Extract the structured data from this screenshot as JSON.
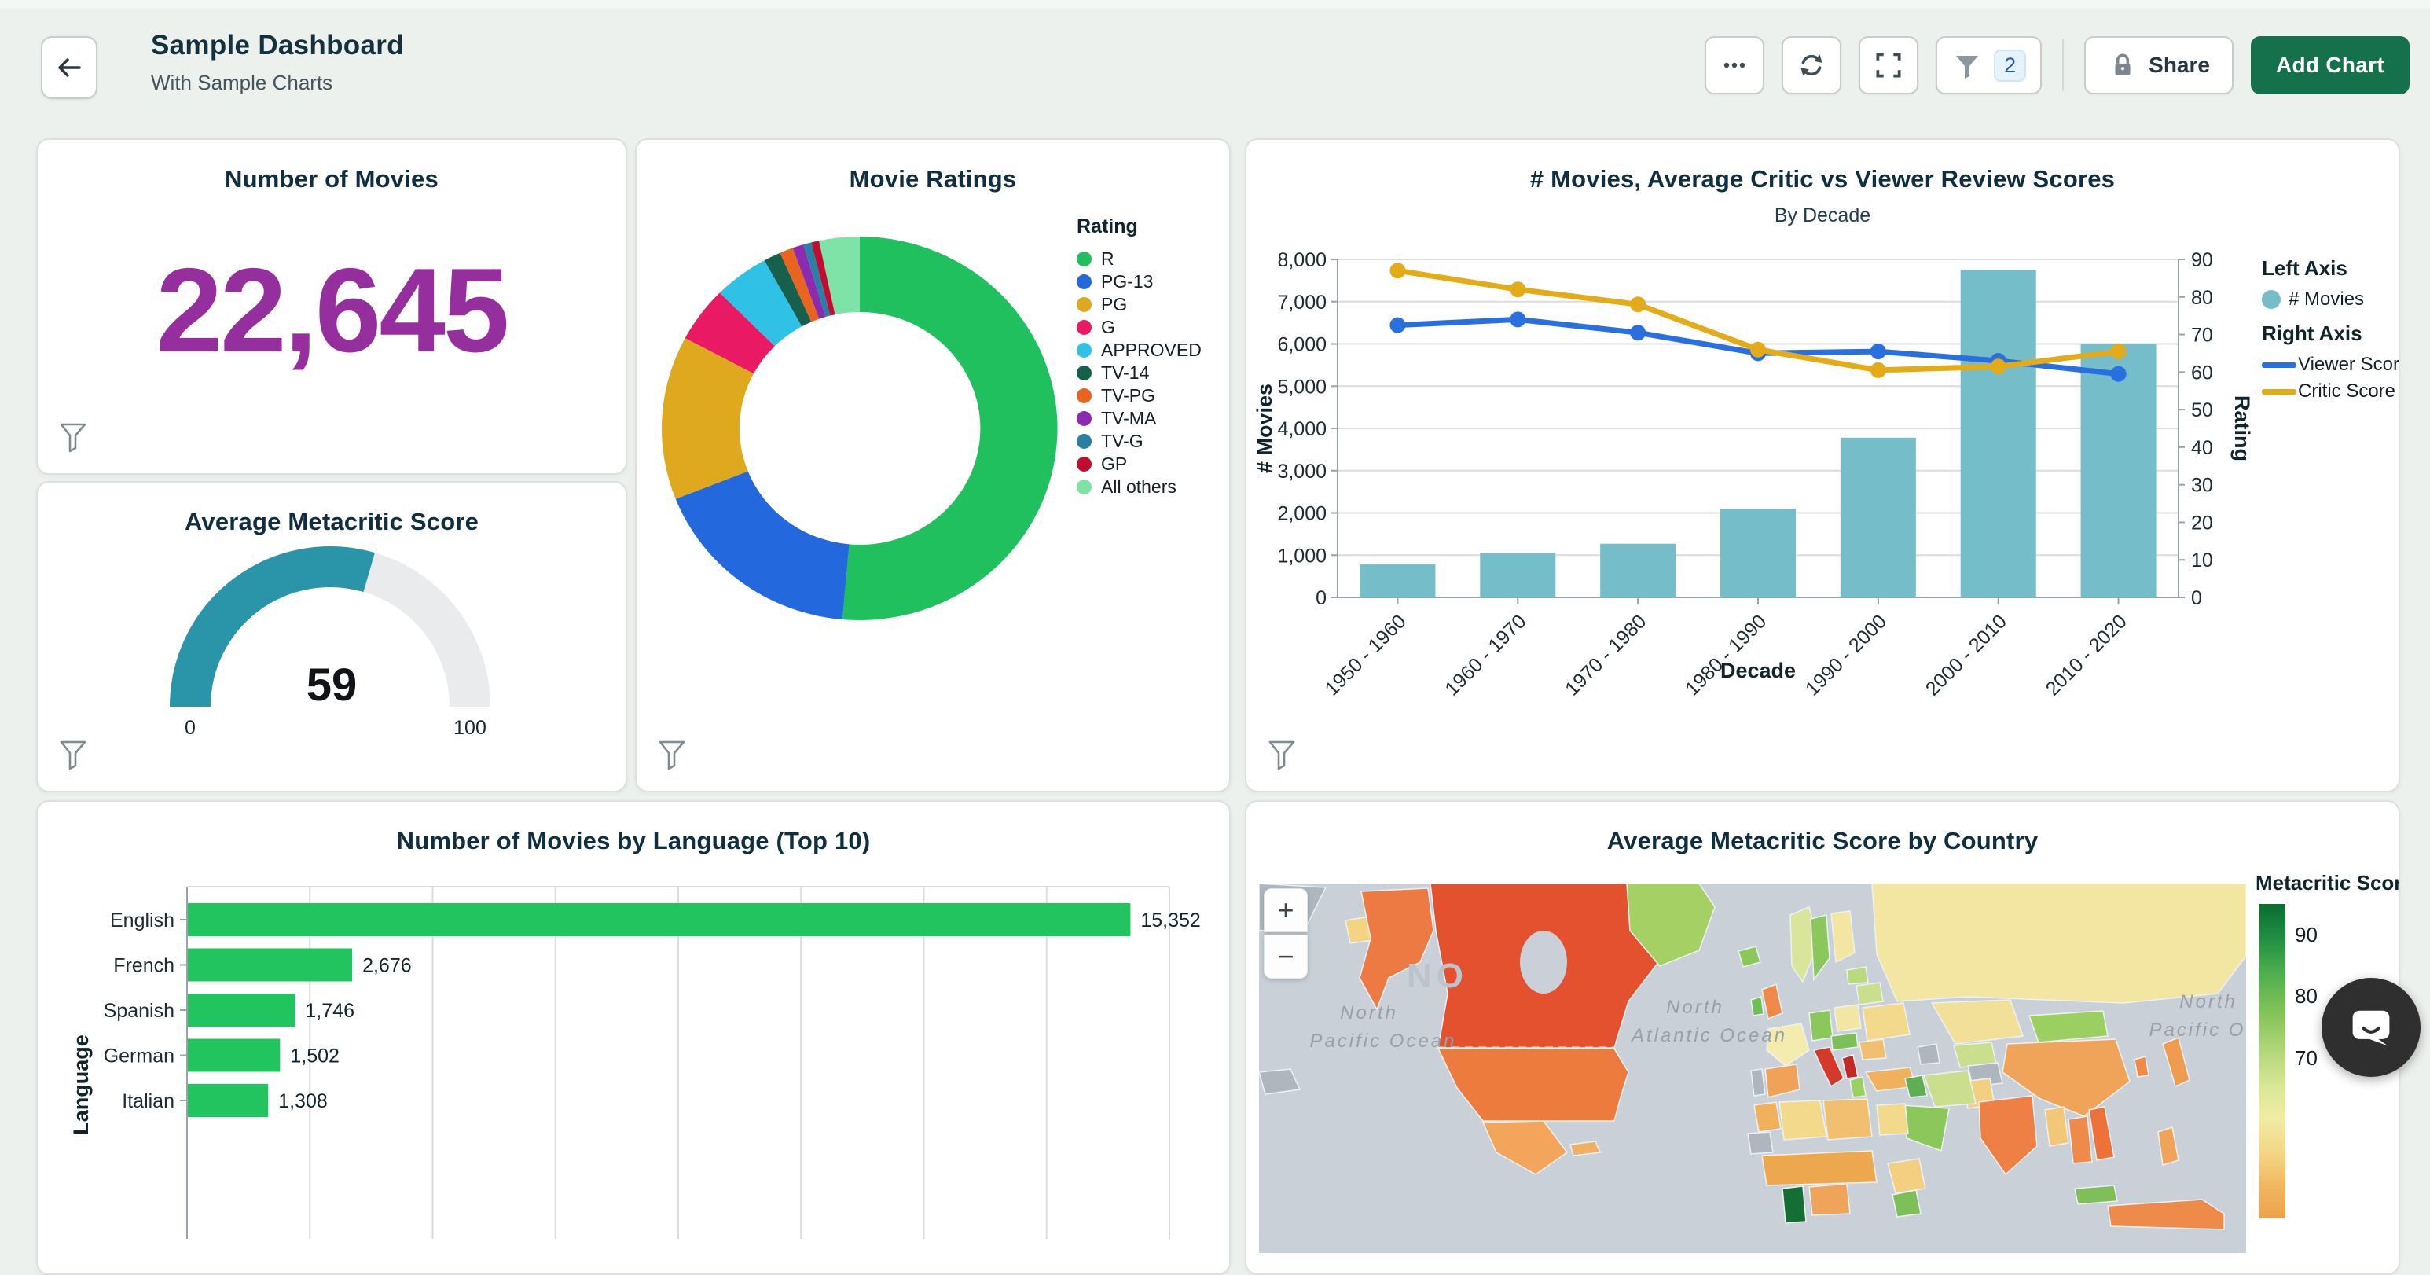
{
  "header": {
    "title": "Sample Dashboard",
    "subtitle": "With Sample Charts",
    "toolbar": {
      "filter_count": "2",
      "share_label": "Share",
      "add_chart_label": "Add Chart"
    }
  },
  "chart_data": [
    {
      "id": "kpi",
      "type": "number",
      "title": "Number of Movies",
      "value": "22,645",
      "color": "#962f9e"
    },
    {
      "id": "donut",
      "type": "pie",
      "title": "Movie Ratings",
      "legend_title": "Rating",
      "labels": [
        "R",
        "PG-13",
        "PG",
        "G",
        "APPROVED",
        "TV-14",
        "TV-PG",
        "TV-MA",
        "TV-G",
        "GP",
        "All others"
      ],
      "values": [
        51.4,
        17.6,
        13.8,
        4.7,
        4.5,
        1.4,
        1.1,
        0.9,
        0.65,
        0.65,
        3.3
      ],
      "colors": [
        "#21c05e",
        "#2468dd",
        "#dea91f",
        "#e91a63",
        "#2fc2e6",
        "#17604d",
        "#e8641f",
        "#8c2bb0",
        "#2a7fa5",
        "#c00d31",
        "#7fe3a8"
      ],
      "legend_position": "right"
    },
    {
      "id": "gauge",
      "type": "gauge",
      "title": "Average Metacritic Score",
      "value": 59,
      "min": 0,
      "max": 100,
      "min_label": "0",
      "max_label": "100",
      "color": "#2a95a9",
      "track_color": "#e9ebed"
    },
    {
      "id": "combo",
      "type": "bar+line",
      "title": "# Movies, Average Critic vs Viewer Review Scores",
      "subtitle": "By Decade",
      "categories": [
        "1950 - 1960",
        "1960 - 1970",
        "1970 - 1980",
        "1980 - 1990",
        "1990 - 2000",
        "2000 - 2010",
        "2010 - 2020"
      ],
      "bar_series": {
        "name": "# Movies",
        "values": [
          780,
          1050,
          1270,
          2100,
          3780,
          7750,
          6000
        ],
        "color": "#75bdc9"
      },
      "line_series": [
        {
          "name": "Viewer Score",
          "values": [
            72.5,
            74,
            70.5,
            65,
            65.5,
            63,
            59.5
          ],
          "color": "#2a6fe0"
        },
        {
          "name": "Critic Score",
          "values": [
            87,
            82,
            78,
            66,
            60.5,
            61.5,
            65.5
          ],
          "color": "#e3ab17"
        }
      ],
      "left_axis": {
        "label": "# Movies",
        "min": 0,
        "max": 8000,
        "tick_step": 1000
      },
      "right_axis": {
        "label": "Rating",
        "min": 0,
        "max": 90,
        "tick_step": 10
      },
      "xlabel": "Decade",
      "legend": {
        "left_header": "Left Axis",
        "right_header": "Right Axis"
      },
      "grid": true
    },
    {
      "id": "languages",
      "type": "bar-horizontal",
      "title": "Number of Movies by Language (Top 10)",
      "ylabel": "Language",
      "categories": [
        "English",
        "French",
        "Spanish",
        "German",
        "Italian"
      ],
      "values": [
        15352,
        2676,
        1746,
        1502,
        1308
      ],
      "value_labels": [
        "15,352",
        "2,676",
        "1,746",
        "1,502",
        "1,308"
      ],
      "xmax": 16000,
      "grid_step": 2000,
      "color": "#21c45e"
    },
    {
      "id": "map",
      "type": "choropleth",
      "title": "Average Metacritic Score by Country",
      "legend_title": "Metacritic Score",
      "legend_ticks": [
        "90",
        "80",
        "70"
      ],
      "zoom_in": "+",
      "zoom_out": "−",
      "ocean_labels": [
        {
          "line1": "North",
          "line2": "Pacific Ocean"
        },
        {
          "line1": "North",
          "line2": "Atlantic Ocean"
        },
        {
          "line1": "North",
          "line2": "Pacific Ocean"
        }
      ]
    }
  ]
}
